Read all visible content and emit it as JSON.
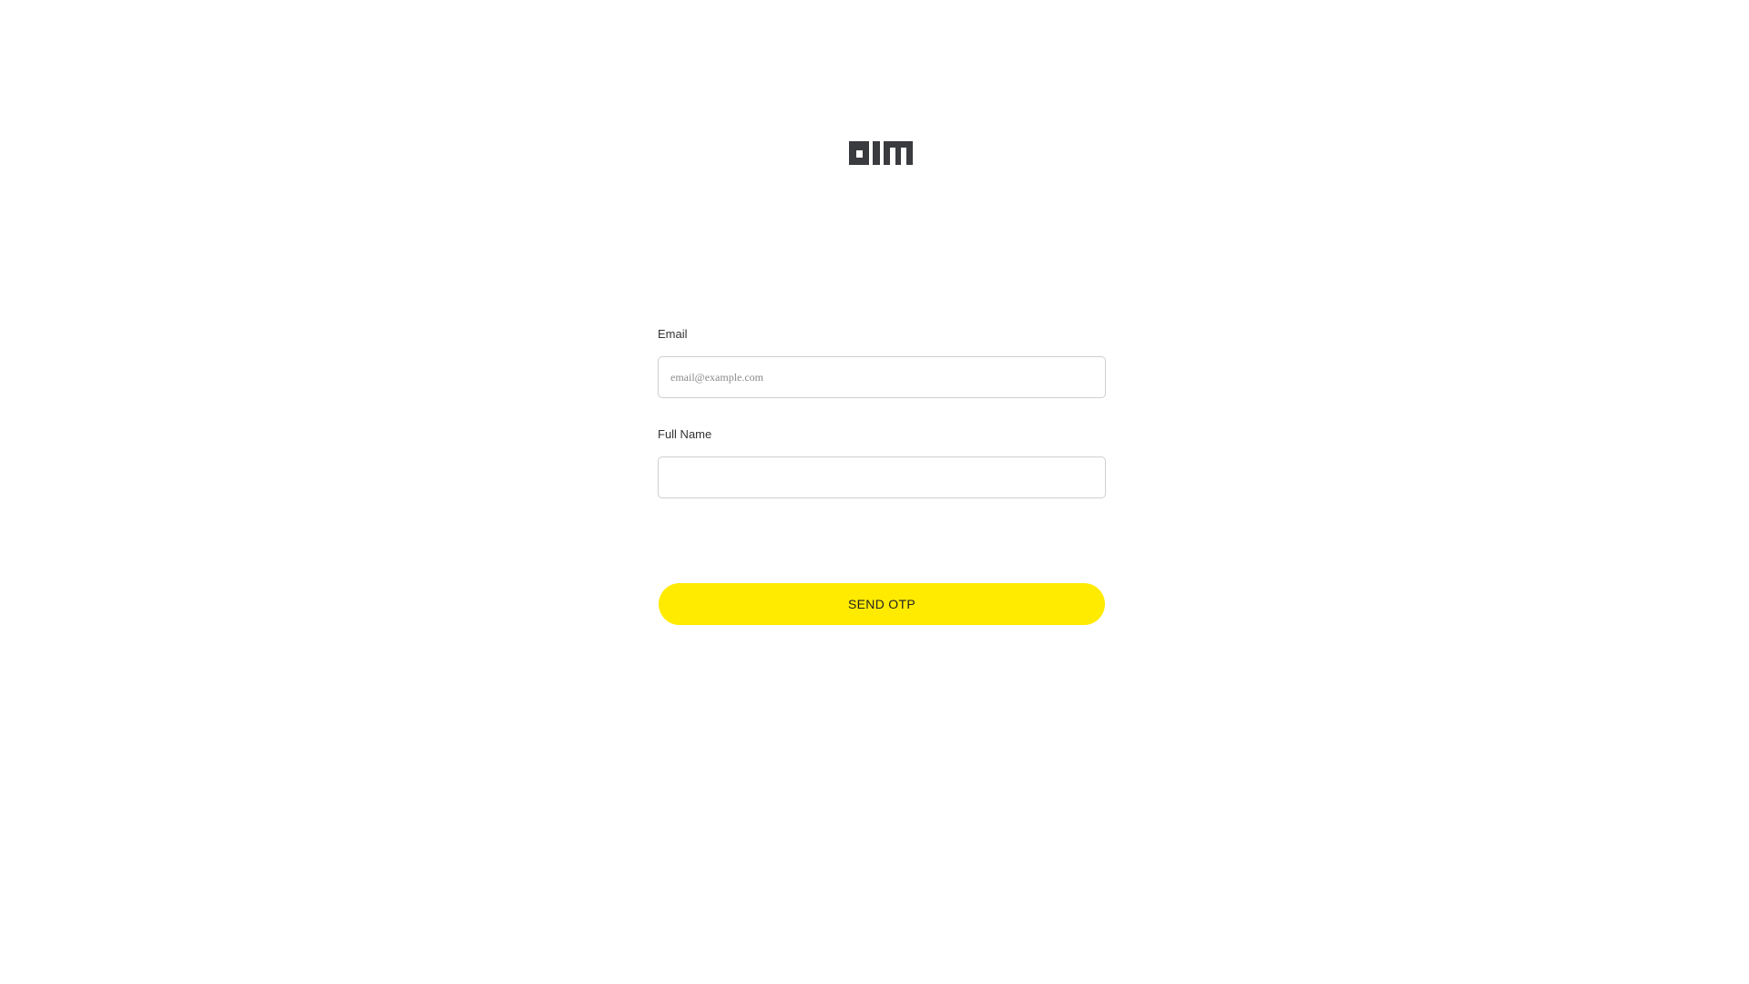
{
  "brand": {
    "logo_icon": "aim-logo",
    "logo_color": "#3a3b3e"
  },
  "form": {
    "email": {
      "label": "Email",
      "placeholder": "email@example.com",
      "value": ""
    },
    "full_name": {
      "label": "Full Name",
      "placeholder": "",
      "value": ""
    },
    "submit_label": "SEND OTP",
    "submit_color": "#ffeb00"
  }
}
